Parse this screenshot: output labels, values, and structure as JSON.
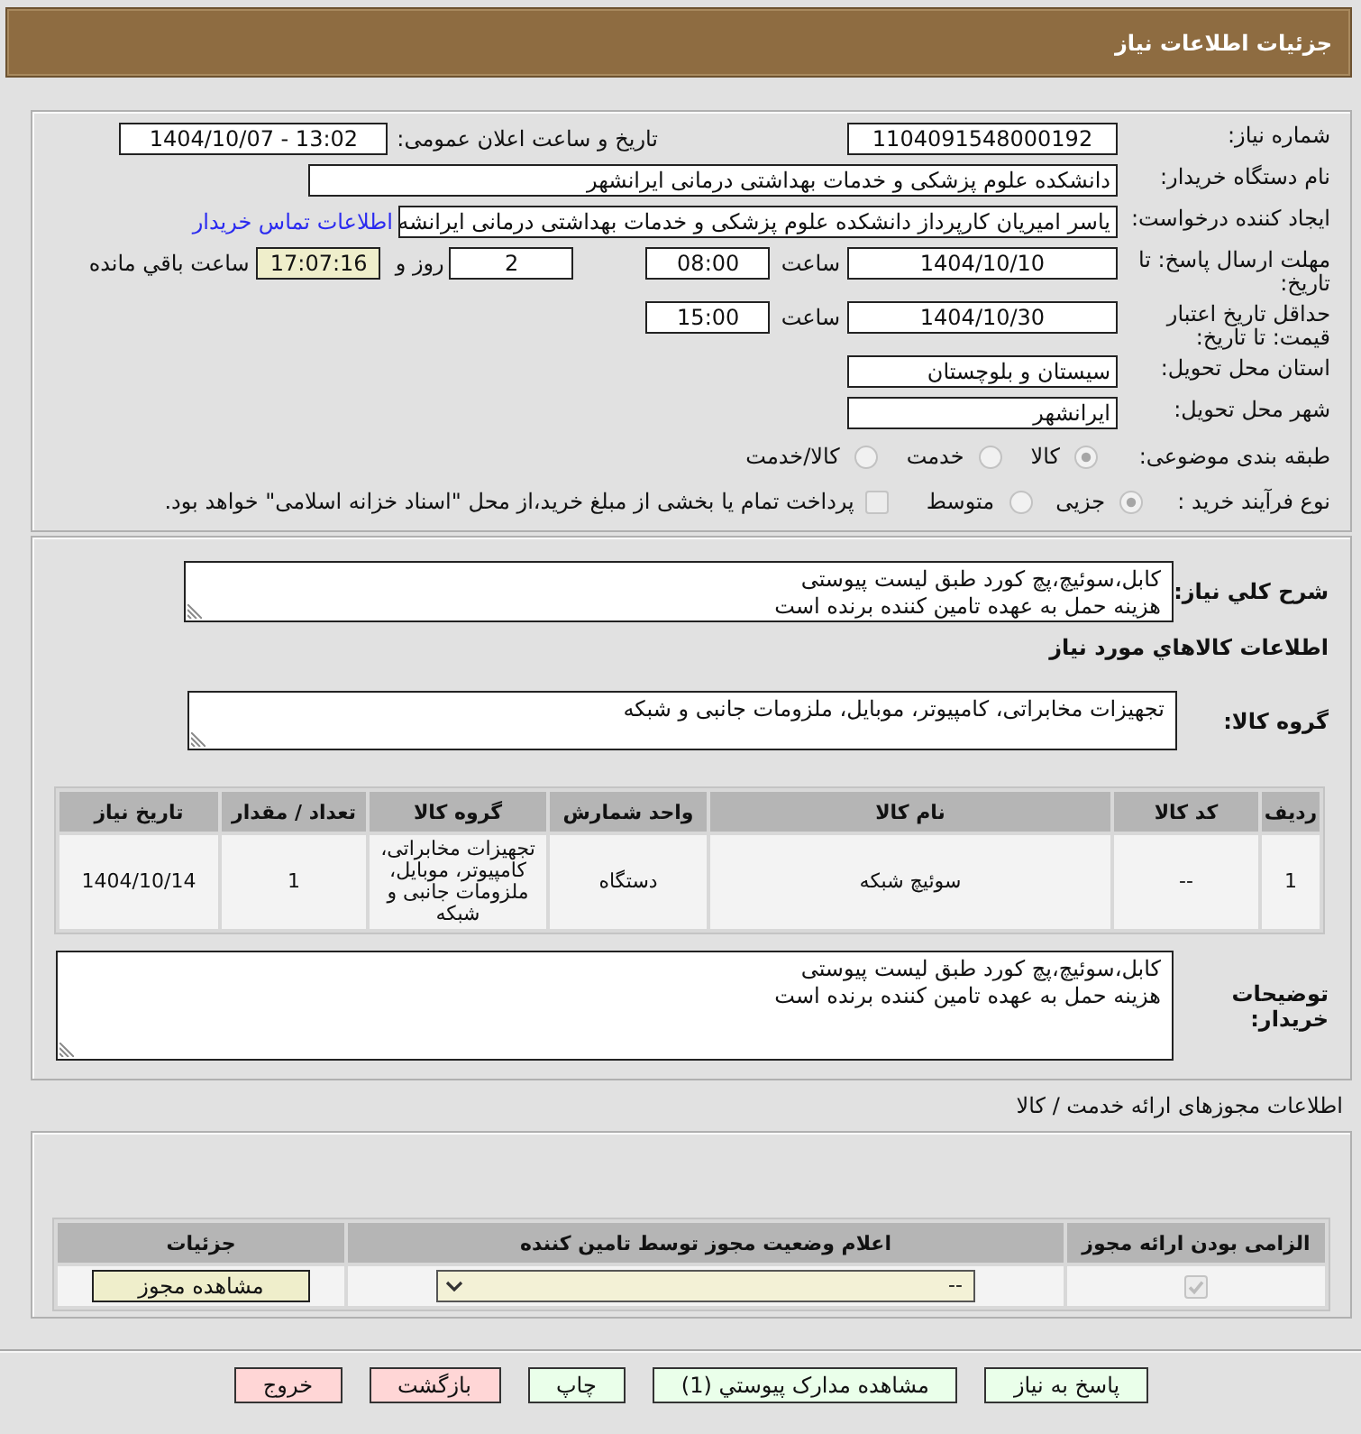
{
  "header": {
    "title": "جزئیات اطلاعات نیاز"
  },
  "details": {
    "need_number": {
      "label": "شماره نیاز:",
      "value": "1104091548000192"
    },
    "announce_datetime": {
      "label": "تاریخ و ساعت اعلان عمومی:",
      "value": "1404/10/07 - 13:02"
    },
    "buyer_org": {
      "label": "نام دستگاه خریدار:",
      "value": "دانشکده علوم پزشکی و خدمات بهداشتی درمانی ایرانشهر"
    },
    "requester": {
      "label": "ایجاد کننده درخواست:",
      "value": "یاسر امیریان کارپرداز دانشکده علوم پزشکی و خدمات بهداشتی درمانی ایرانشه",
      "link": "اطلاعات تماس خریدار"
    },
    "reply_deadline": {
      "label": "مهلت ارسال پاسخ: تا تاریخ:",
      "date": "1404/10/10",
      "time_label": "ساعت",
      "time": "08:00",
      "days": "2",
      "days_label": "روز و",
      "remaining": "17:07:16",
      "remaining_label": "ساعت باقي مانده"
    },
    "price_validity": {
      "label": "حداقل تاریخ اعتبار قیمت: تا تاریخ:",
      "date": "1404/10/30",
      "time_label": "ساعت",
      "time": "15:00"
    },
    "province": {
      "label": "استان محل تحویل:",
      "value": "سیستان و بلوچستان"
    },
    "city": {
      "label": "شهر محل تحویل:",
      "value": "ایرانشهر"
    },
    "category": {
      "label": "طبقه بندی موضوعی:",
      "disabled": true,
      "options": [
        {
          "label": "کالا",
          "selected": true
        },
        {
          "label": "خدمت",
          "selected": false
        },
        {
          "label": "کالا/خدمت",
          "selected": false
        }
      ]
    },
    "purchase_type": {
      "label": "نوع فرآیند خرید :",
      "disabled": true,
      "options": [
        {
          "label": "جزیی",
          "selected": true
        },
        {
          "label": "متوسط",
          "selected": false
        }
      ],
      "treasury": {
        "checked": false,
        "text": "پرداخت تمام یا بخشی از مبلغ خرید،از محل \"اسناد خزانه اسلامی\" خواهد بود."
      }
    }
  },
  "need": {
    "summary": {
      "label": "شرح کلي نیاز:",
      "lines": [
        "کابل،سوئیچ،پچ کورد طبق لیست پیوستی",
        "هزینه حمل به عهده تامین کننده برنده است"
      ]
    },
    "goods_title": "اطلاعات کالاهاي مورد نیاز",
    "goods_group": {
      "label": "گروه کالا:",
      "value": "تجهیزات مخابراتی، کامپیوتر، موبایل، ملزومات جانبی و شبکه"
    },
    "table": {
      "columns": [
        "ردیف",
        "کد کالا",
        "نام کالا",
        "واحد شمارش",
        "گروه کالا",
        "تعداد / مقدار",
        "تاریخ نیاز"
      ],
      "rows": [
        [
          "1",
          "--",
          "سوئیچ شبکه",
          "دستگاه",
          "تجهیزات مخابراتی، کامپیوتر، موبایل، ملزومات جانبی و شبکه",
          "1",
          "1404/10/14"
        ]
      ]
    },
    "buyer_notes": {
      "label": "توضیحات خریدار:",
      "lines": [
        "کابل،سوئیچ،پچ کورد طبق لیست پیوستی",
        "هزینه حمل به عهده تامین کننده برنده است"
      ]
    }
  },
  "permits": {
    "title": "اطلاعات مجوزهای ارائه خدمت / کالا",
    "columns": [
      "الزامی بودن ارائه مجوز",
      "اعلام وضعیت مجوز توسط تامین کننده",
      "جزئیات"
    ],
    "rows": [
      {
        "checked": true,
        "disabled": true,
        "status": "--",
        "action": "مشاهده مجوز"
      }
    ]
  },
  "actions": [
    {
      "label": "پاسخ به نیاز",
      "kind": "primary"
    },
    {
      "label": "مشاهده مدارک پیوستي (1)",
      "kind": "primary"
    },
    {
      "label": "چاپ",
      "kind": "primary"
    },
    {
      "label": "بازگشت",
      "kind": "danger"
    },
    {
      "label": "خروج",
      "kind": "danger"
    }
  ]
}
